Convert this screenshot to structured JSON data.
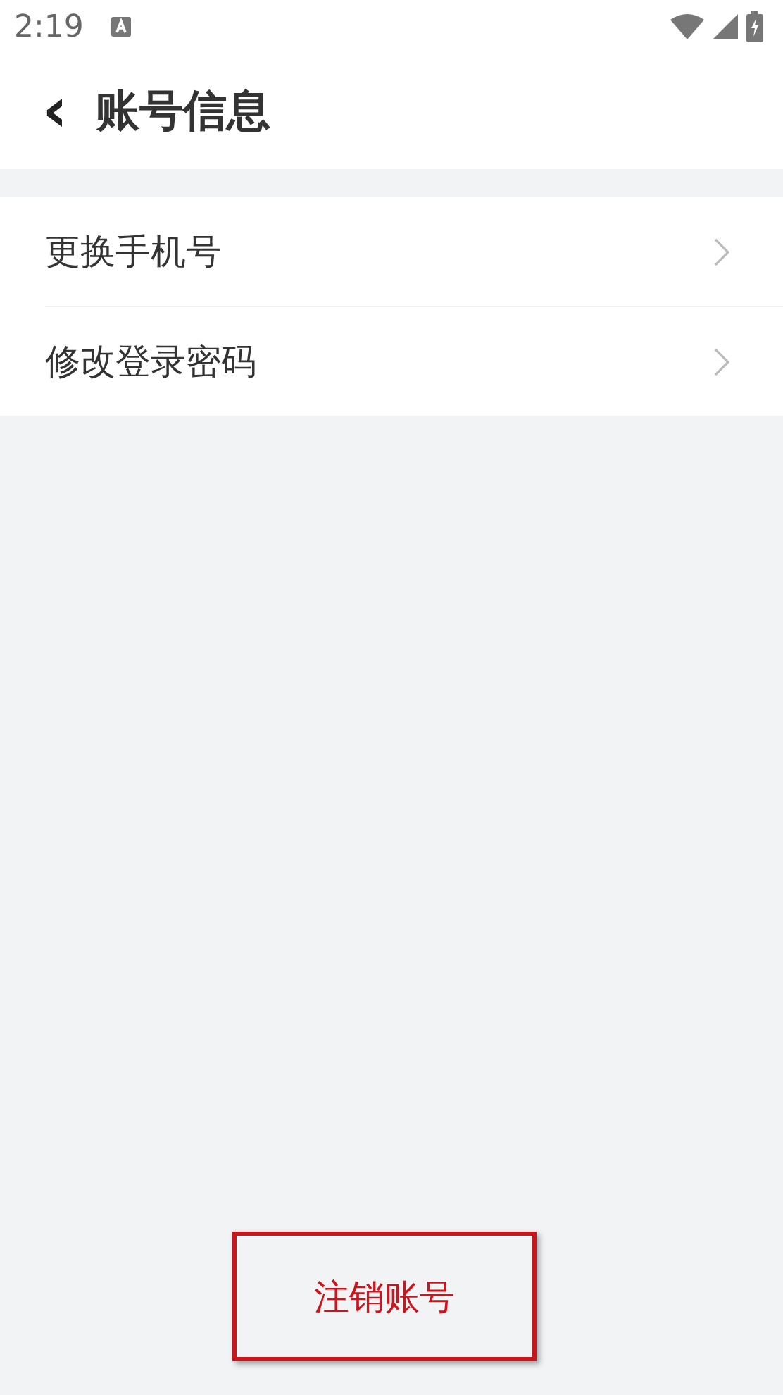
{
  "status_bar": {
    "time": "2:19"
  },
  "header": {
    "back": "‹",
    "title": "账号信息"
  },
  "menu_items": [
    {
      "label": "更换手机号"
    },
    {
      "label": "修改登录密码"
    }
  ],
  "cancel_button": {
    "label": "注销账号",
    "highlighted": true
  }
}
